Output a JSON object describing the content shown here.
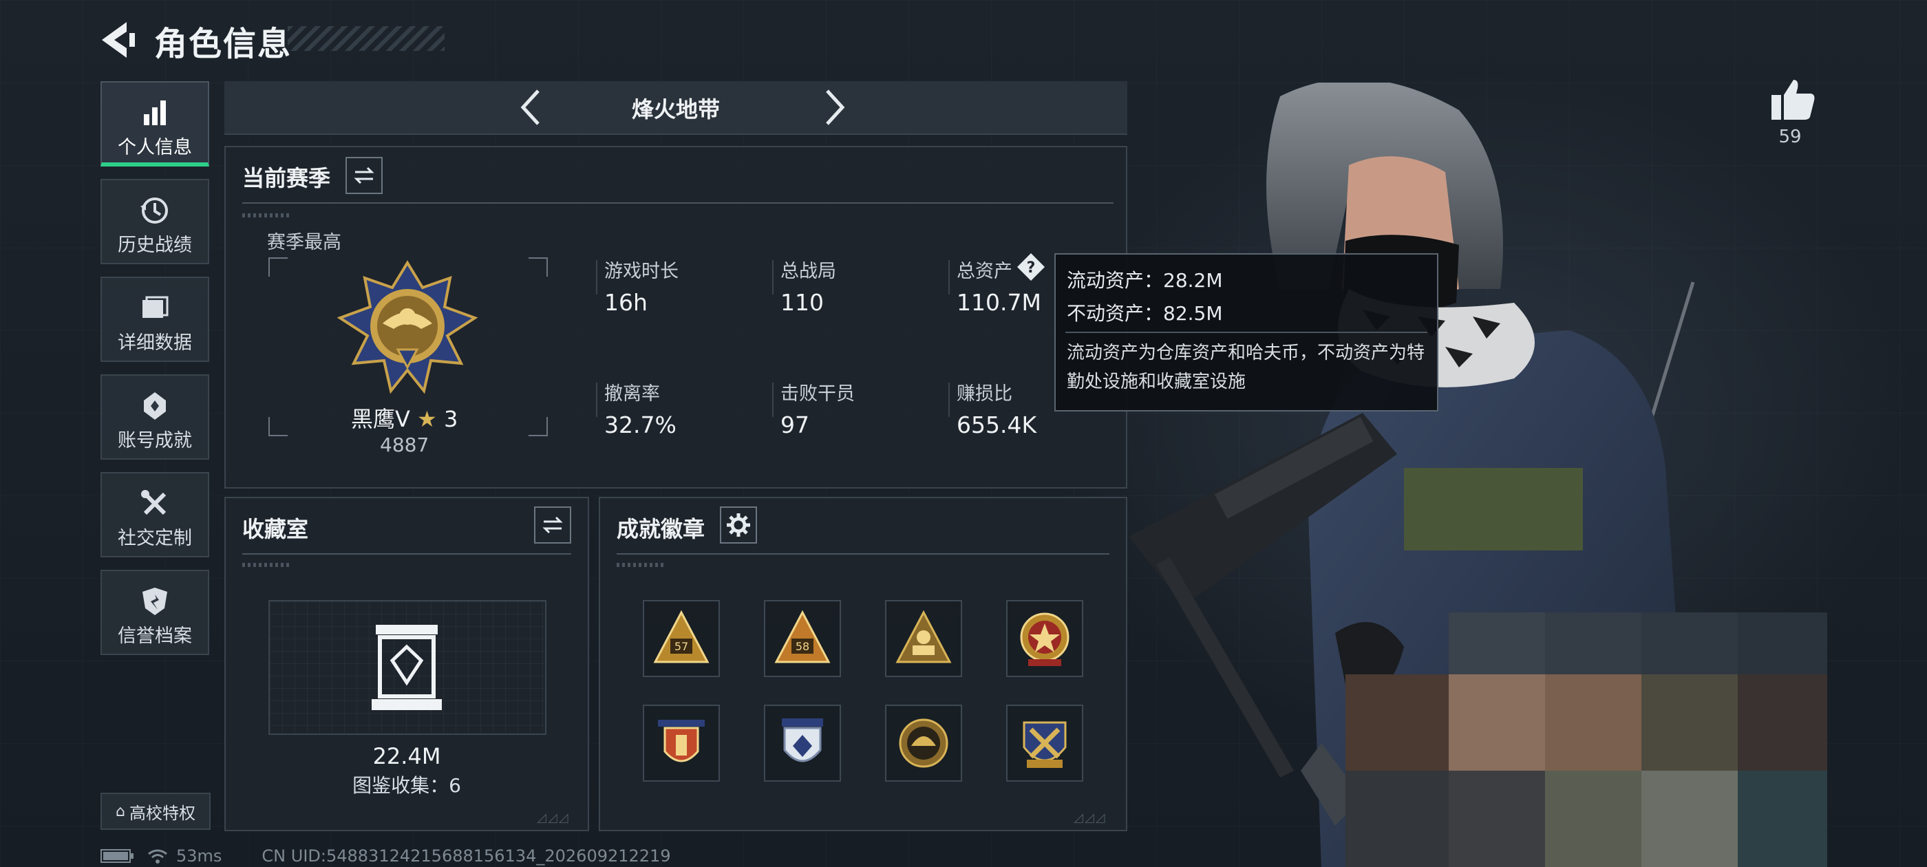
{
  "header": {
    "title": "角色信息"
  },
  "sidebar": {
    "items": [
      {
        "label": "个人信息",
        "icon": "bar-chart-icon",
        "active": true
      },
      {
        "label": "历史战绩",
        "icon": "history-icon",
        "active": false
      },
      {
        "label": "详细数据",
        "icon": "folder-icon",
        "active": false
      },
      {
        "label": "账号成就",
        "icon": "achievement-icon",
        "active": false
      },
      {
        "label": "社交定制",
        "icon": "tools-icon",
        "active": false
      },
      {
        "label": "信誉档案",
        "icon": "shield-icon",
        "active": false
      }
    ],
    "campus_label": "高校特权"
  },
  "mode_bar": {
    "title": "烽火地带"
  },
  "season": {
    "title": "当前赛季",
    "best_label": "赛季最高",
    "rank_name": "黑鹰Ⅴ",
    "rank_stars": "3",
    "rank_score": "4887",
    "stats": [
      {
        "label": "游戏时长",
        "value": "16h"
      },
      {
        "label": "总战局",
        "value": "110"
      },
      {
        "label": "总资产",
        "value": "110.7M"
      },
      {
        "label": "撤离率",
        "value": "32.7%"
      },
      {
        "label": "击败干员",
        "value": "97"
      },
      {
        "label": "赚损比",
        "value": "655.4K"
      }
    ]
  },
  "tooltip": {
    "liquid": "流动资产：28.2M",
    "fixed": "不动资产：82.5M",
    "description": "流动资产为仓库资产和哈夫币，不动资产为特勤处设施和收藏室设施"
  },
  "collection": {
    "title": "收藏室",
    "value": "22.4M",
    "count_label": "图鉴收集：6"
  },
  "badges": {
    "title": "成就徽章",
    "items": [
      {
        "icon": "triangle-badge-57-icon",
        "text": "57"
      },
      {
        "icon": "triangle-badge-58-icon",
        "text": "58"
      },
      {
        "icon": "triangle-soldier-badge-icon",
        "text": ""
      },
      {
        "icon": "star-emblem-badge-icon",
        "text": ""
      },
      {
        "icon": "red-shield-badge-icon",
        "text": ""
      },
      {
        "icon": "blue-shield-badge-icon",
        "text": ""
      },
      {
        "icon": "round-helmet-badge-icon",
        "text": ""
      },
      {
        "icon": "wrench-shield-badge-icon",
        "text": ""
      }
    ]
  },
  "likes": {
    "count": "59"
  },
  "status": {
    "ping": "53ms",
    "uid": "CN UID:5488312421568815613​4_202609212219"
  },
  "colors": {
    "accent": "#2ecf8a",
    "panel": "#1e252d",
    "gold": "#c9a24a"
  }
}
